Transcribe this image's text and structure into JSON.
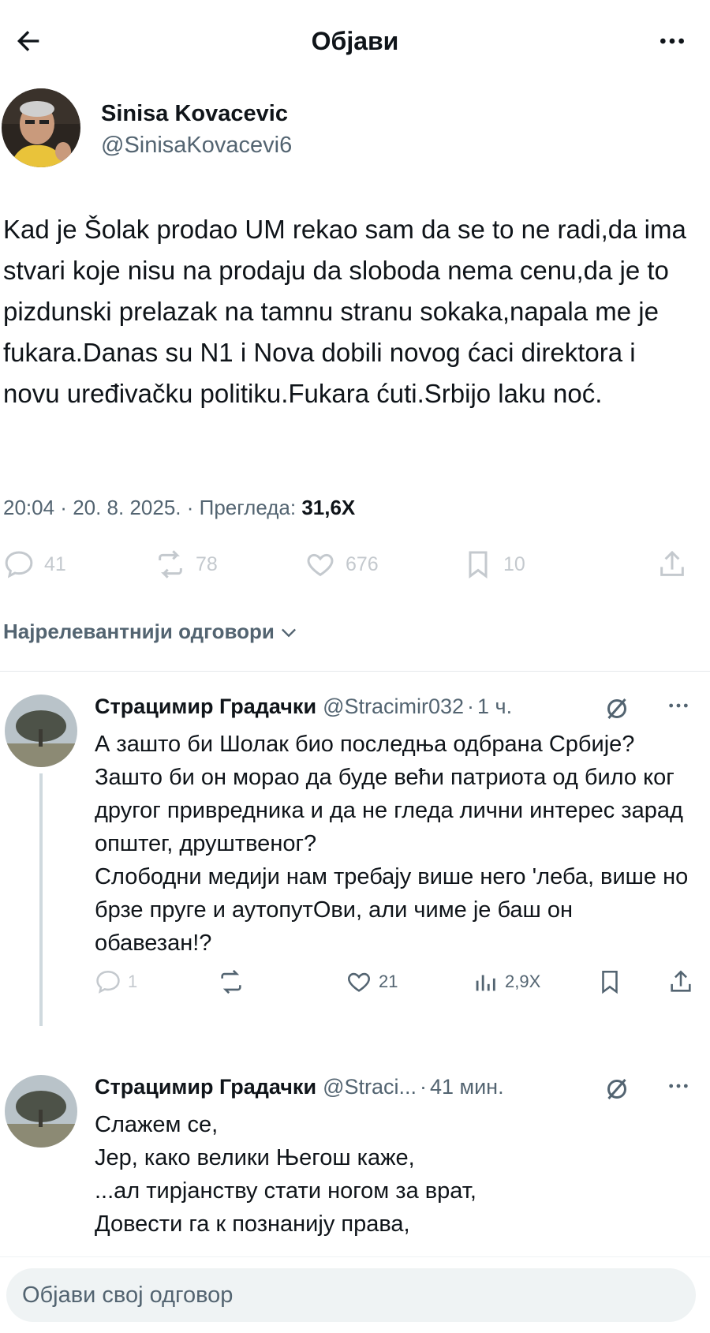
{
  "header": {
    "title": "Објави",
    "back_icon": "arrow-left-icon",
    "more_icon": "more-horizontal-icon"
  },
  "tweet": {
    "author_name": "Sinisa Kovacevic",
    "author_handle": "@SinisaKovacevi6",
    "text": "Kad je Šolak prodao UM rekao sam da se to ne radi,da ima stvari koje nisu na prodaju da sloboda nema cenu,da je to pizdunski prelazak na tamnu stranu sokaka,napala me je fukara.Danas su N1 i Nova dobili novog ćaci direktora i novu uređivačku politiku.Fukara ćuti.Srbijo laku noć.",
    "time": "20:04",
    "date": "20. 8. 2025.",
    "views_label": "Прегледа:",
    "views": "31,6Х",
    "replies": "41",
    "reposts": "78",
    "likes": "676",
    "bookmarks": "10"
  },
  "sort": {
    "label": "Најрелевантнији одговори"
  },
  "replies": [
    {
      "name": "Страцимир Градачки",
      "handle": "@Stracimir032",
      "time": "1 ч.",
      "text": "А зашто би Шолак био последња одбрана Србије?\nЗашто би он морао да буде већи патриота од било ког другог привредника и да не гледа лични интерес зарад општег, друштвеног?\nСлободни медији нам требају више него 'леба, више но брзе пруге и аутопутОви, али чиме је баш он обавезан!?",
      "replies": "1",
      "reposts": "",
      "likes": "21",
      "views": "2,9Х"
    },
    {
      "name": "Страцимир Градачки",
      "handle": "@Straci...",
      "time": "41 мин.",
      "text": "Слажем се,\nЈер, како велики Његош каже,\n...ал тирјанству стати ногом за врат,\nДовести га к познанију права,"
    }
  ],
  "compose": {
    "placeholder": "Објави свој одговор"
  },
  "colors": {
    "text": "#0f1419",
    "secondary": "#536471",
    "muted_icon": "#c4c9ce",
    "compose_bg": "#eff3f4"
  }
}
